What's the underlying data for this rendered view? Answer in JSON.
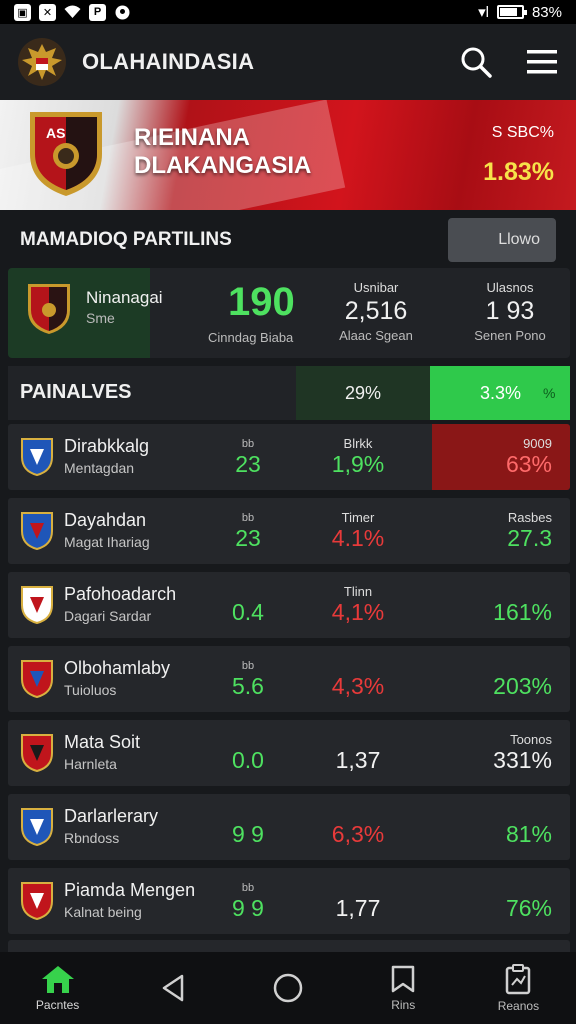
{
  "status_bar": {
    "left_icons": [
      "image-icon",
      "x-icon",
      "wifi-icon",
      "p-icon",
      "location-icon"
    ],
    "signal": "▾l",
    "battery_text": "83%",
    "battery_level": 0.83
  },
  "app_bar": {
    "title": "OLAHAINDASIA",
    "icons": [
      "search-icon",
      "menu-icon"
    ]
  },
  "banner": {
    "crest_text": "AS",
    "title_line1": "RIEINANA",
    "title_line2": "DLAKANGASIA",
    "code": "S SBC%",
    "percent": "1.83%"
  },
  "section": {
    "title": "MAMADIOQ PARTILINS",
    "button_label": "Llowo"
  },
  "featured": {
    "name": "Ninanagai",
    "sub": "Sme",
    "big_value": "190",
    "big_label": "Cinndag Biaba",
    "col2": {
      "label": "Usnibar",
      "value": "2,516",
      "sub": "Alaac Sgean"
    },
    "col3": {
      "label": "Ulasnos",
      "value": "1 93",
      "sub": "Senen Pono"
    }
  },
  "table_header": {
    "title": "PAINALVES",
    "mid": "29%",
    "right": "3.3%",
    "right_icon": "%"
  },
  "rows": [
    {
      "name": "Dirabkkalg",
      "sub": "Mentagdan",
      "c1_label": "bb",
      "c1": "23",
      "c2_label": "Blrkk",
      "c2": "1,9%",
      "c3_label": "9009",
      "c3": "63%"
    },
    {
      "name": "Dayahdan",
      "sub": "Magat Ihariag",
      "c1_label": "bb",
      "c1": "23",
      "c2_label": "Timer",
      "c2": "4.1%",
      "c3_label": "Rasbes",
      "c3": "27.3"
    },
    {
      "name": "Pafohoadarch",
      "sub": "Dagari Sardar",
      "c1_label": "",
      "c1": "0.4",
      "c2_label": "Tlinn",
      "c2": "4,1%",
      "c3_label": "",
      "c3": "161%"
    },
    {
      "name": "Olbohamlaby",
      "sub": "Tuioluos",
      "c1_label": "bb",
      "c1": "5.6",
      "c2_label": "",
      "c2": "4,3%",
      "c3_label": "",
      "c3": "203%"
    },
    {
      "name": "Mata Soit",
      "sub": "Harnleta",
      "c1_label": "",
      "c1": "0.0",
      "c2_label": "",
      "c2": "1,37",
      "c3_label": "Toonos",
      "c3": "331%"
    },
    {
      "name": "Darlarlerary",
      "sub": "Rbndoss",
      "c1_label": "",
      "c1": "9 9",
      "c2_label": "",
      "c2": "6,3%",
      "c3_label": "",
      "c3": "81%"
    },
    {
      "name": "Piamda Mengen",
      "sub": "Kalnat being",
      "c1_label": "bb",
      "c1": "9 9",
      "c2_label": "",
      "c2": "1,77",
      "c3_label": "",
      "c3": "76%"
    }
  ],
  "bottom_nav": [
    {
      "label": "Pacntes",
      "icon": "home-icon"
    },
    {
      "label": "",
      "icon": "back-icon"
    },
    {
      "label": "",
      "icon": "circle-icon"
    },
    {
      "label": "Rins",
      "icon": "bookmark-icon"
    },
    {
      "label": "Reanos",
      "icon": "clipboard-icon"
    }
  ],
  "colors": {
    "accent_green": "#4ee160",
    "accent_red": "#e83a3a",
    "banner_red": "#d2141c",
    "gold": "#f6e24a"
  }
}
